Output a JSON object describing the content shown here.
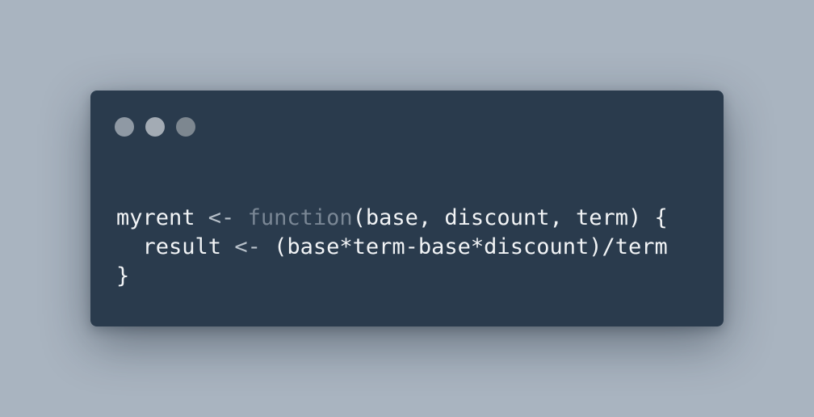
{
  "window": {
    "controls": [
      {
        "name": "close",
        "color": "#8f99a4"
      },
      {
        "name": "minimize",
        "color": "#a3abb4"
      },
      {
        "name": "maximize",
        "color": "#7d8790"
      }
    ]
  },
  "code": {
    "line1": {
      "name": "myrent",
      "assign": " <- ",
      "keyword": "function",
      "signature": "(base, discount, term) {"
    },
    "line2": {
      "indent": "  ",
      "name": "result",
      "assign": " <- ",
      "expression": "(base*term-base*discount)/term"
    },
    "line3": {
      "text": "}"
    }
  },
  "colors": {
    "background": "#a9b4c0",
    "window": "#2a3b4d",
    "text": "#f2f4f6",
    "keyword": "#7a8795"
  }
}
